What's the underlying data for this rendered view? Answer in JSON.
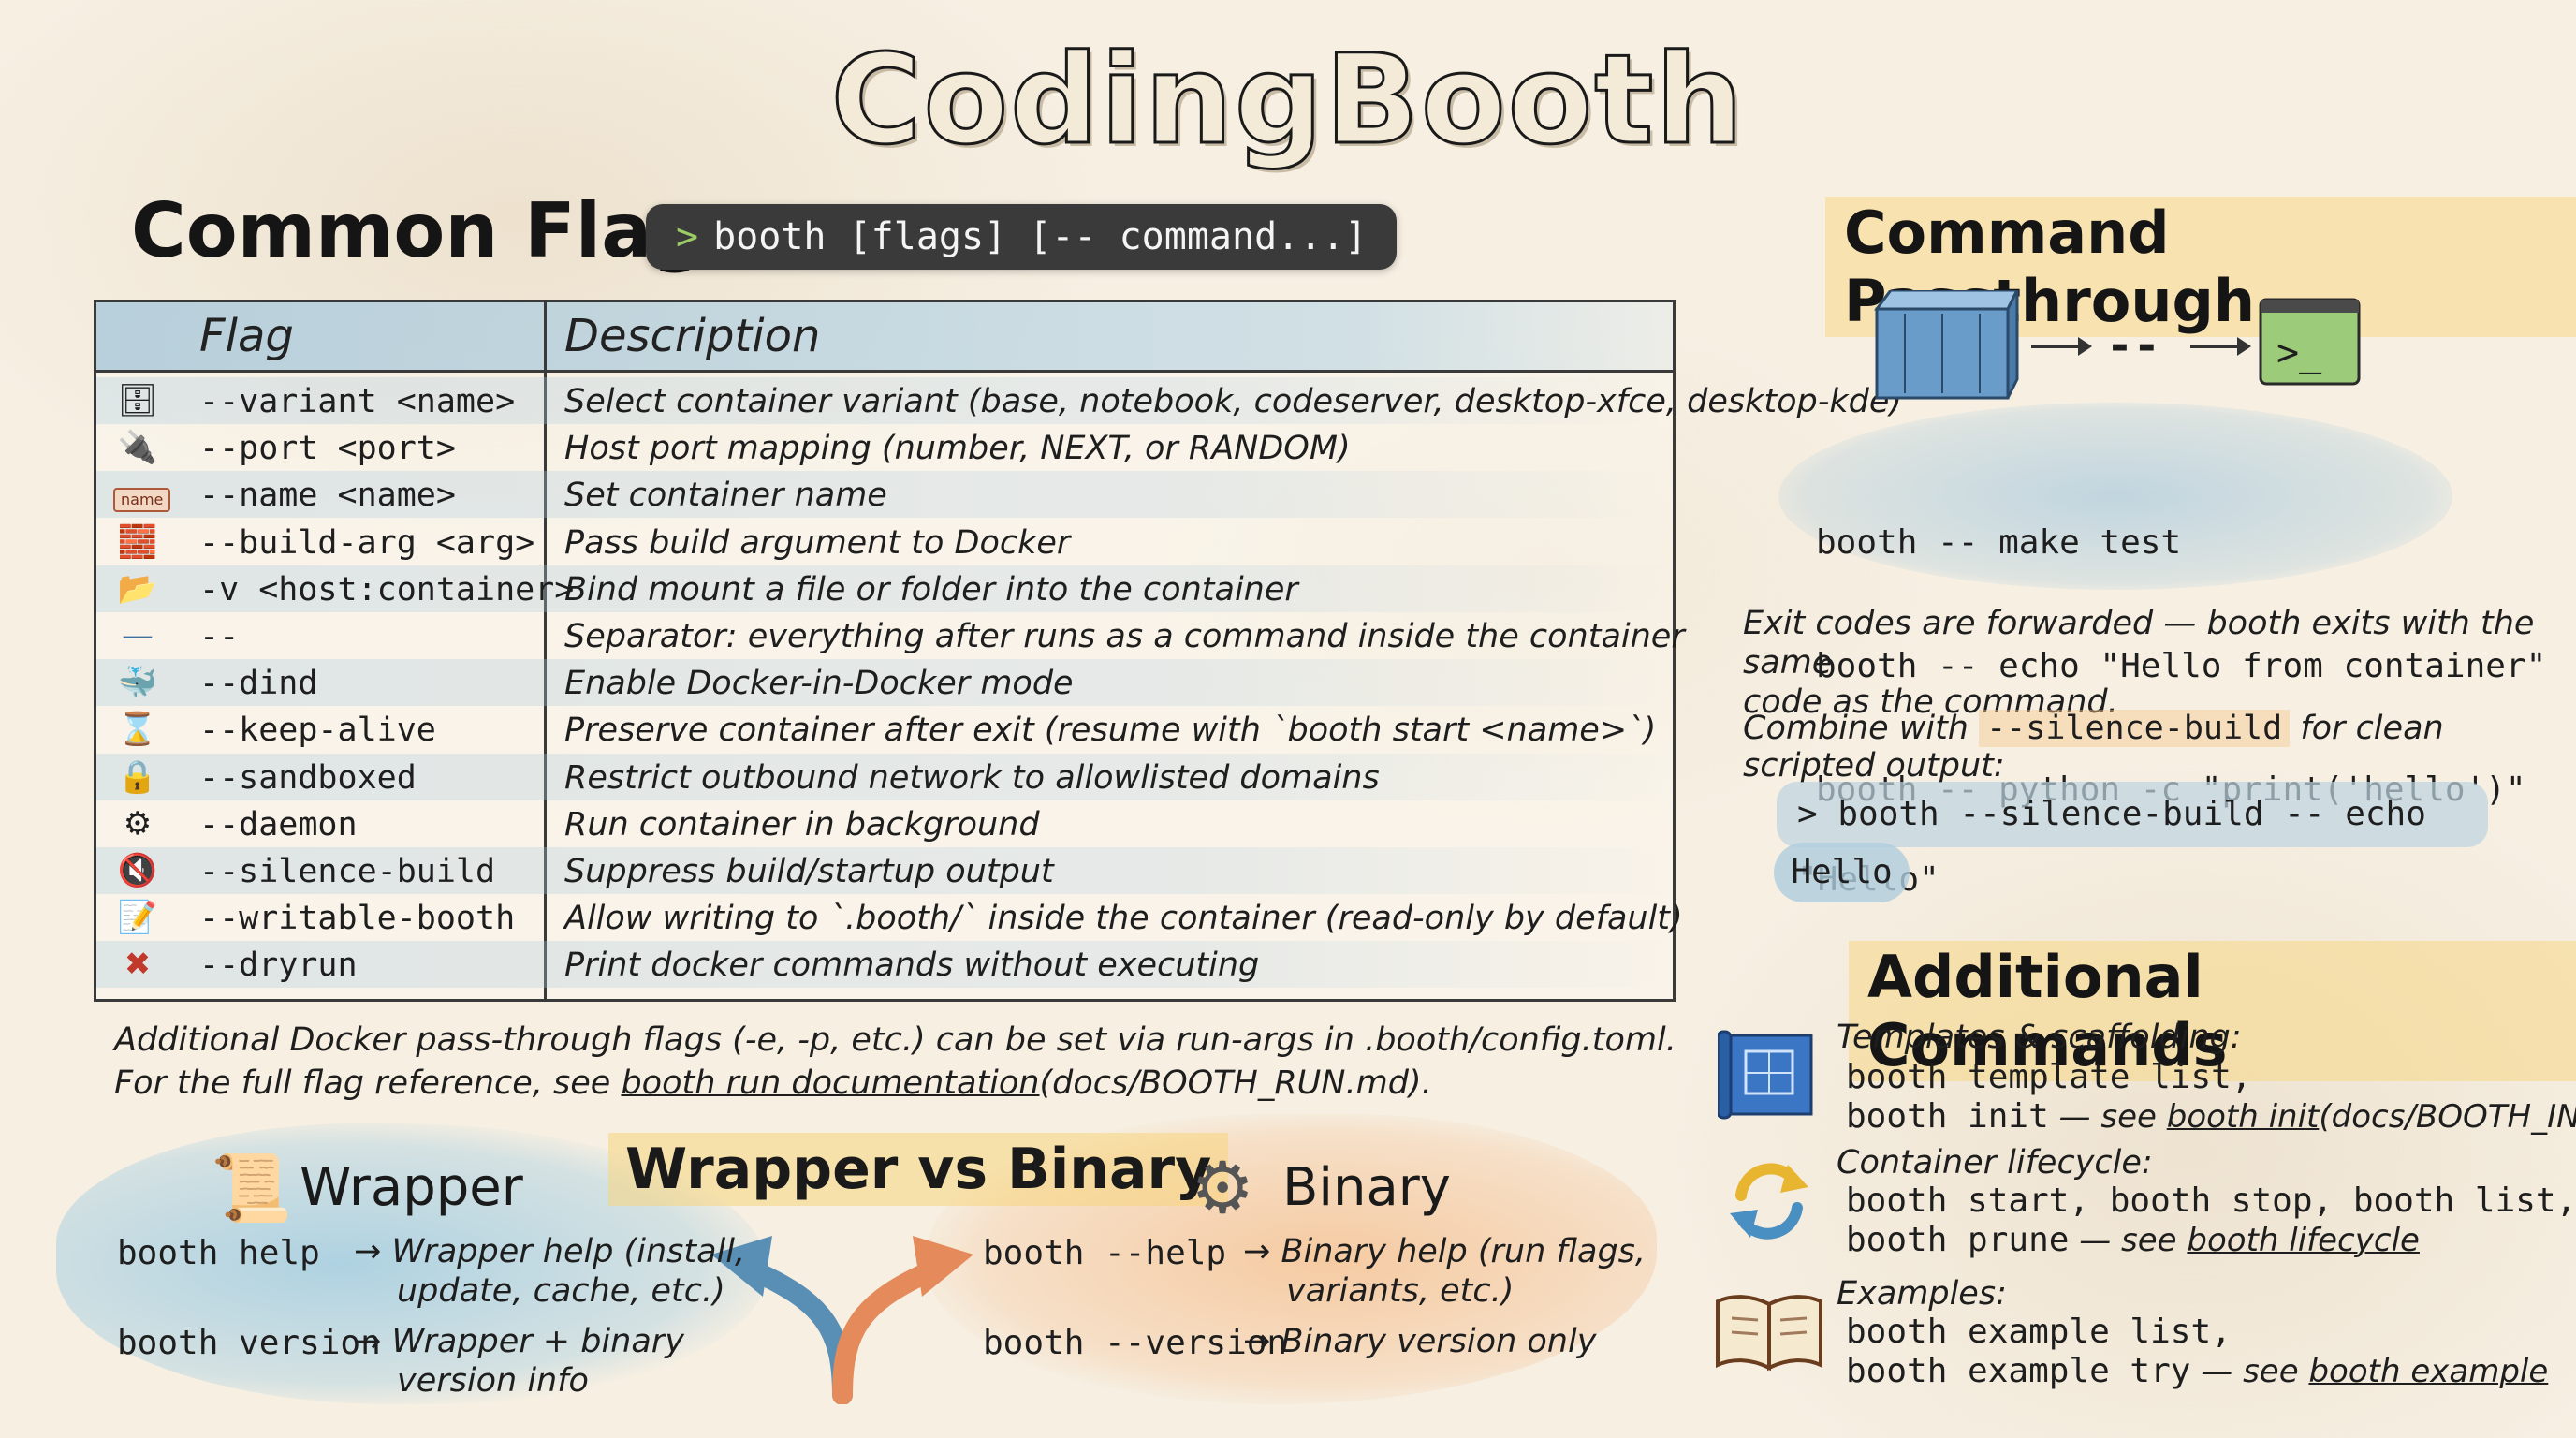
{
  "title": "CodingBooth",
  "common_flags": {
    "heading": "Common Flags",
    "usage": "booth [flags] [-- command...]",
    "columns": [
      "Flag",
      "Description"
    ],
    "rows": [
      {
        "icon": "containers-icon",
        "flag": "--variant <name>",
        "desc": "Select container variant (base, notebook, codeserver, desktop-xfce, desktop-kde)"
      },
      {
        "icon": "port-icon",
        "flag": "--port <port>",
        "desc": "Host port mapping (number, NEXT, or RANDOM)"
      },
      {
        "icon": "name-tag-icon",
        "icon_text": "name",
        "flag": "--name <name>",
        "desc": "Set container name"
      },
      {
        "icon": "blocks-icon",
        "flag": "--build-arg <arg>",
        "desc": "Pass build argument to Docker"
      },
      {
        "icon": "folder-sync-icon",
        "flag": "-v <host:container>",
        "desc": "Bind mount a file or folder into the container"
      },
      {
        "icon": "separator-line-icon",
        "flag": "--",
        "desc": "Separator: everything after runs as a command inside the container"
      },
      {
        "icon": "docker-whale-icon",
        "flag": "--dind",
        "desc": "Enable Docker-in-Docker mode"
      },
      {
        "icon": "hourglass-icon",
        "flag": "--keep-alive",
        "desc": "Preserve container after exit (resume with `booth start <name>`)"
      },
      {
        "icon": "lock-icon",
        "flag": "--sandboxed",
        "desc": "Restrict outbound network to allowlisted domains"
      },
      {
        "icon": "gears-icon",
        "flag": "--daemon",
        "desc": "Run container in background"
      },
      {
        "icon": "mute-speaker-icon",
        "flag": "--silence-build",
        "desc": "Suppress build/startup output"
      },
      {
        "icon": "edit-note-icon",
        "flag": "--writable-booth",
        "desc": "Allow writing to `.booth/` inside the container (read-only by default)"
      },
      {
        "icon": "red-x-icon",
        "flag": "--dryrun",
        "desc": "Print docker commands without executing"
      }
    ],
    "footnote_line1": "Additional Docker pass-through flags (-e, -p, etc.) can be set via run-args in .booth/config.toml.",
    "footnote_line2_prefix": "For the full flag reference, see ",
    "footnote_link": "booth run documentation",
    "footnote_line2_suffix": "(docs/BOOTH_RUN.md)."
  },
  "wrapper_vs_binary": {
    "title": "Wrapper vs Binary",
    "wrapper": {
      "label": "Wrapper",
      "rows": [
        {
          "cmd": "booth help",
          "arrow": "→",
          "note1": "Wrapper help (install,",
          "note2": "update, cache, etc.)"
        },
        {
          "cmd": "booth version",
          "arrow": "→",
          "note1": "Wrapper + binary",
          "note2": "version info"
        }
      ]
    },
    "binary": {
      "label": "Binary",
      "rows": [
        {
          "cmd": "booth --help",
          "arrow": "→",
          "note1": "Binary help (run flags,",
          "note2": "variants, etc.)"
        },
        {
          "cmd": "booth --version",
          "arrow": "→",
          "note1": "Binary version only",
          "note2": ""
        }
      ]
    }
  },
  "command_passthrough": {
    "heading": "Command Passthrough",
    "diagram_separator": "--",
    "terminal_glyph": ">_",
    "examples": [
      "booth -- make test",
      "booth -- echo \"Hello from container\"",
      "booth -- python -c \"print('hello')\""
    ],
    "exit_note_1": "Exit codes are forwarded — booth exits with the same",
    "exit_note_2": "code as the command.",
    "combine_prefix": "Combine with ",
    "combine_flag": "--silence-build",
    "combine_suffix": " for clean scripted output:",
    "example_cmd": "> booth --silence-build -- echo \"Hello\"",
    "example_output": "Hello"
  },
  "additional_commands": {
    "heading": "Additional Commands",
    "groups": [
      {
        "icon": "blueprint-icon",
        "caption": "Templates & scaffolding:",
        "line1": "booth template list,",
        "line2_cmd": "booth init",
        "line2_see": " — see ",
        "line2_link": "booth init",
        "line2_tail": "(docs/BOOTH_INIT)"
      },
      {
        "icon": "cycle-arrows-icon",
        "caption": "Container lifecycle:",
        "line1": "booth start, booth stop, booth list,",
        "line2_cmd": "booth prune",
        "line2_see": " — see ",
        "line2_link": "booth lifecycle",
        "line2_tail": ""
      },
      {
        "icon": "open-book-icon",
        "caption": "Examples:",
        "line1": "booth example list,",
        "line2_cmd": "booth example try",
        "line2_see": " — see ",
        "line2_link": "booth example",
        "line2_tail": ""
      }
    ]
  }
}
